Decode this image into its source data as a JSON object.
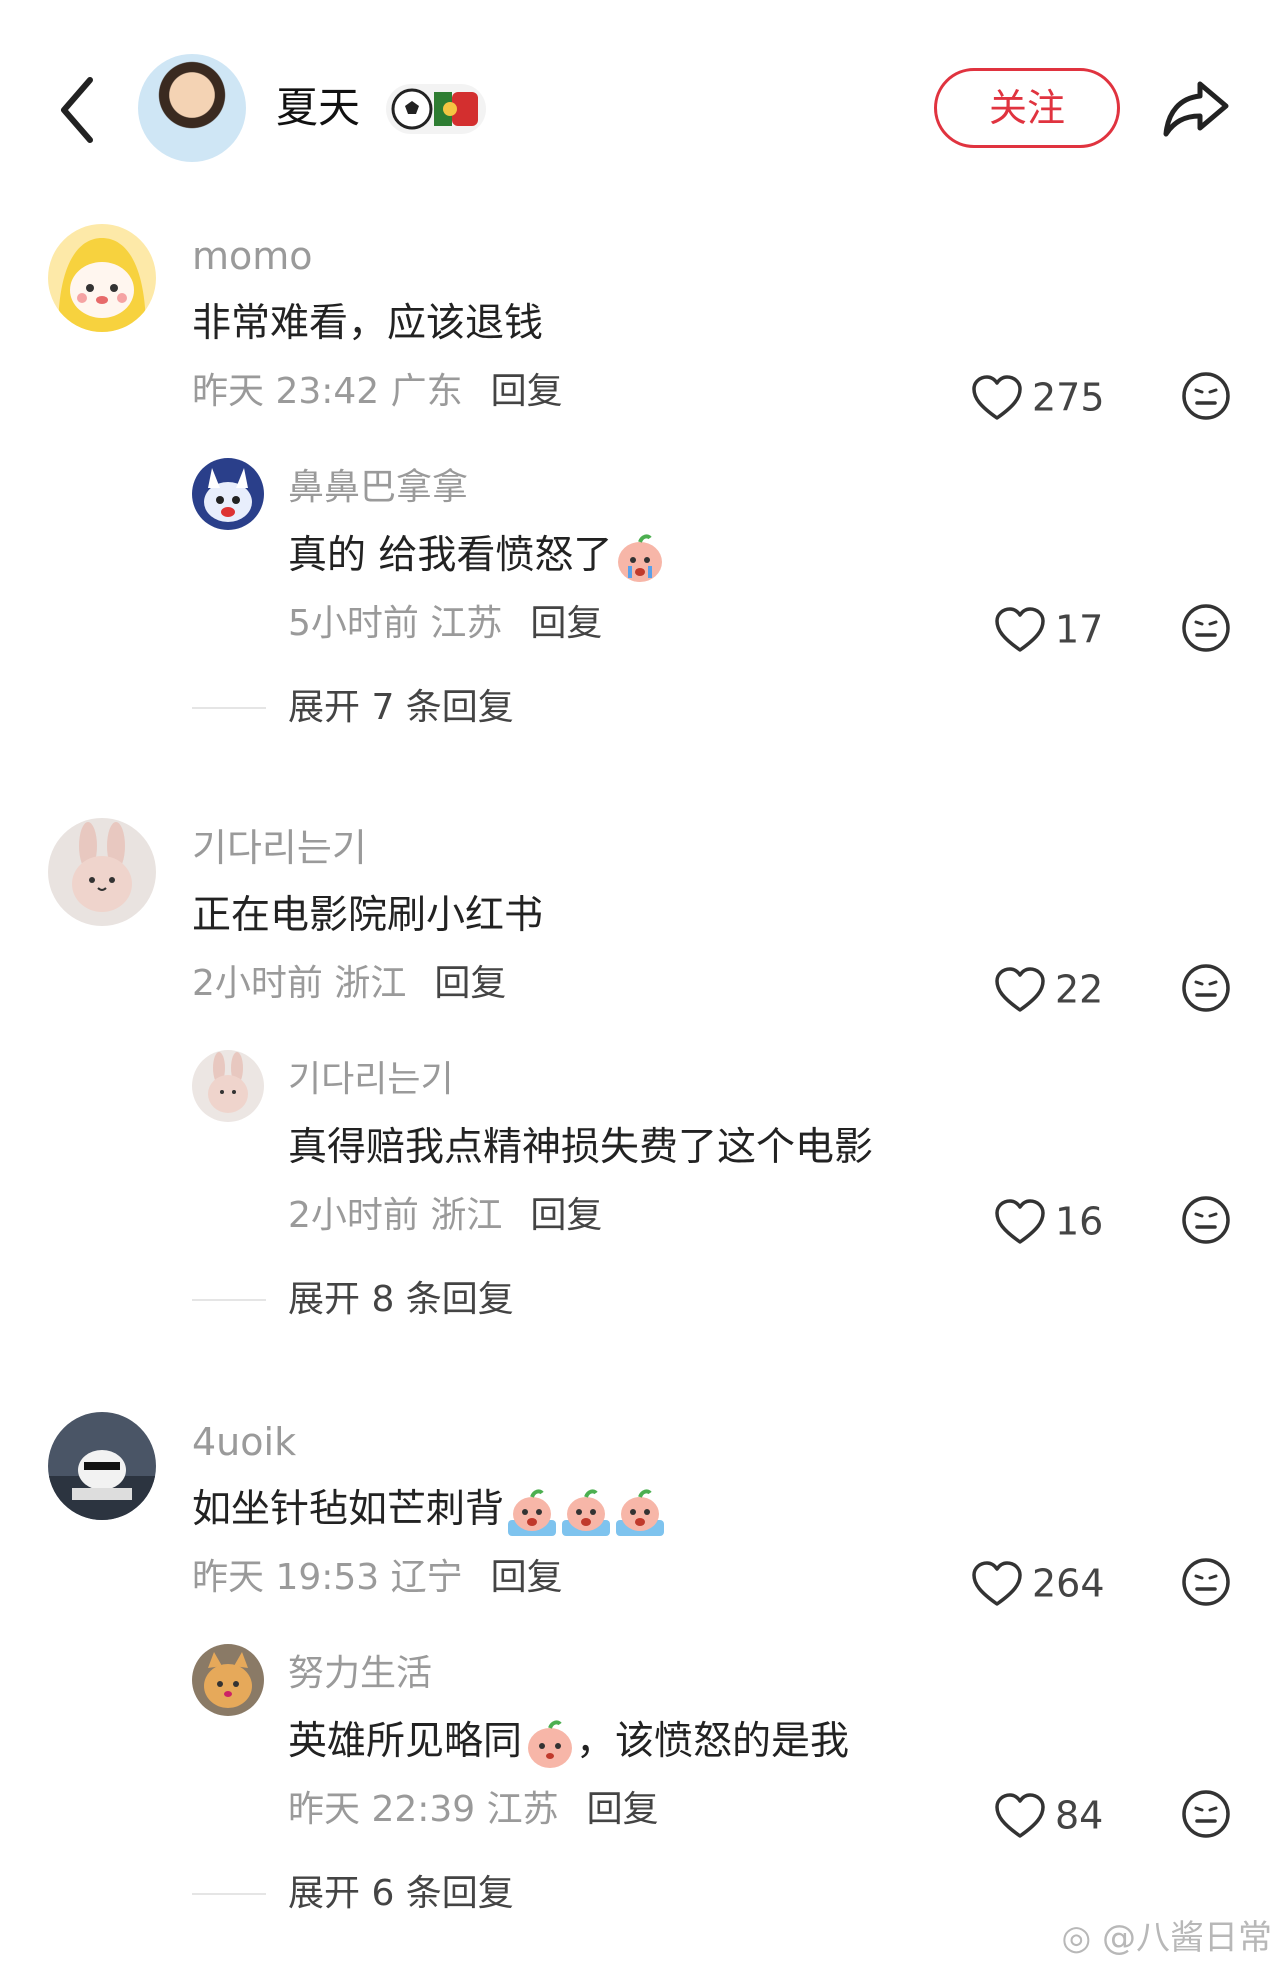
{
  "header": {
    "title": "夏天",
    "follow_label": "关注",
    "back_icon": "chevron-left-icon",
    "share_icon": "share-arrow-icon",
    "badge_icons": [
      "soccer-ball-icon",
      "portugal-flag-icon"
    ]
  },
  "comments": [
    {
      "user": "momo",
      "text": "非常难看，应该退钱",
      "time": "昨天 23:42 广东",
      "reply_label": "回复",
      "likes": "275",
      "replies": [
        {
          "user": "鼻鼻巴拿拿",
          "text": "真的 给我看愤怒了",
          "time": "5小时前 江苏",
          "reply_label": "回复",
          "likes": "17"
        }
      ],
      "expand_label": "展开 7 条回复"
    },
    {
      "user": "기다리는기",
      "text": "正在电影院刷小红书",
      "time": "2小时前 浙江",
      "reply_label": "回复",
      "likes": "22",
      "replies": [
        {
          "user": "기다리는기",
          "text": "真得赔我点精神损失费了这个电影",
          "time": "2小时前 浙江",
          "reply_label": "回复",
          "likes": "16"
        }
      ],
      "expand_label": "展开 8 条回复"
    },
    {
      "user": "4uoik",
      "text": "如坐针毡如芒刺背",
      "time": "昨天 19:53 辽宁",
      "reply_label": "回复",
      "likes": "264",
      "replies": [
        {
          "user": "努力生活",
          "text_before": "英雄所见略同",
          "text_after": "，该愤怒的是我",
          "time": "昨天 22:39 江苏",
          "reply_label": "回复",
          "likes": "84"
        }
      ],
      "expand_label": "展开 6 条回复"
    }
  ],
  "watermark": "@八酱日常",
  "colors": {
    "accent": "#e0333f",
    "muted": "#9a9a9a"
  }
}
